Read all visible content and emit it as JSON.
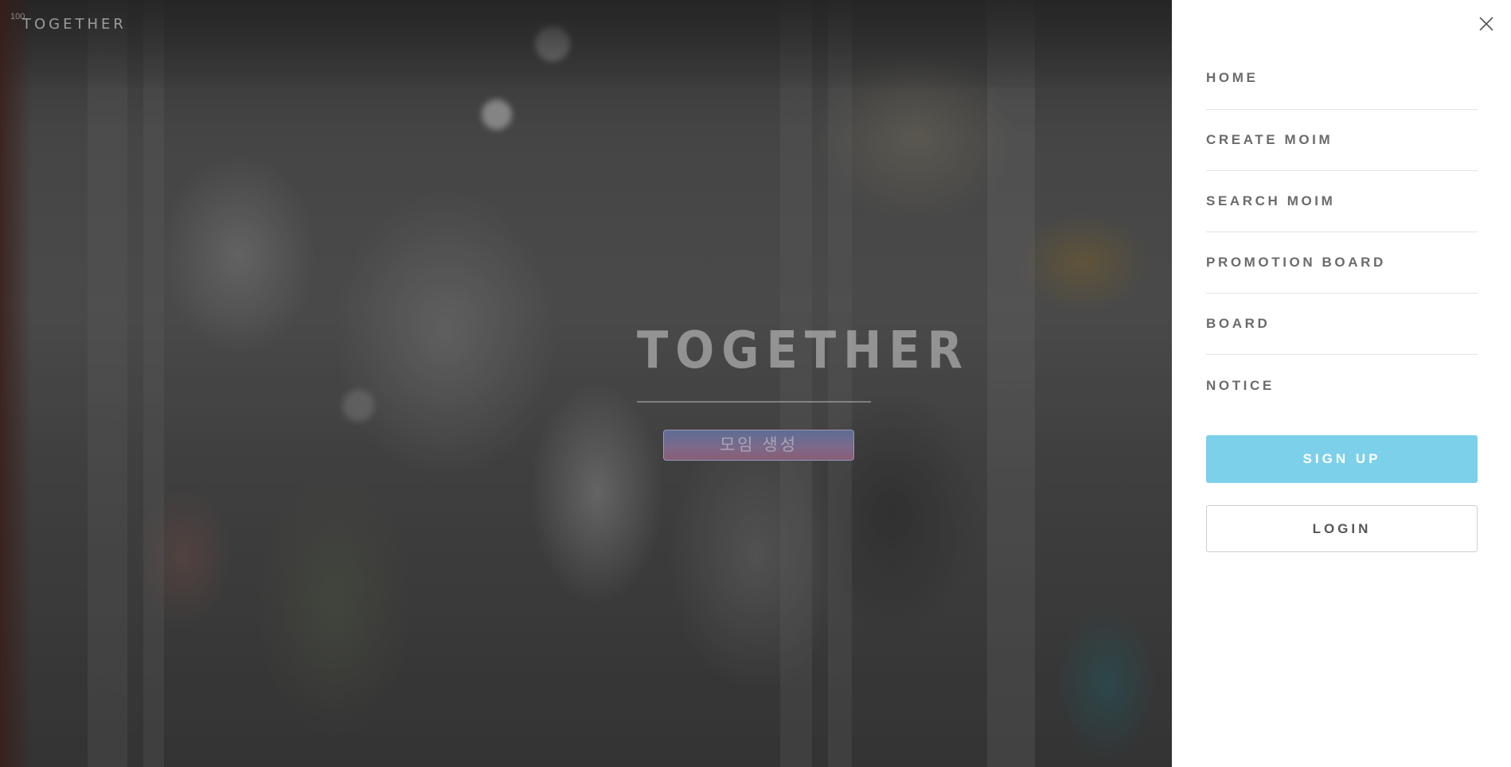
{
  "header": {
    "counter": "100",
    "brand": "TOGETHER"
  },
  "hero": {
    "title": "TOGETHER",
    "create_button_label": "모임 생성"
  },
  "sidebar": {
    "close_icon": "close-icon",
    "items": [
      {
        "label": "HOME"
      },
      {
        "label": "CREATE MOIM"
      },
      {
        "label": "SEARCH MOIM"
      },
      {
        "label": "PROMOTION BOARD"
      },
      {
        "label": "BOARD"
      },
      {
        "label": "NOTICE"
      }
    ],
    "signup_label": "SIGN UP",
    "login_label": "LOGIN",
    "signup_color": "#7dd0ea"
  }
}
